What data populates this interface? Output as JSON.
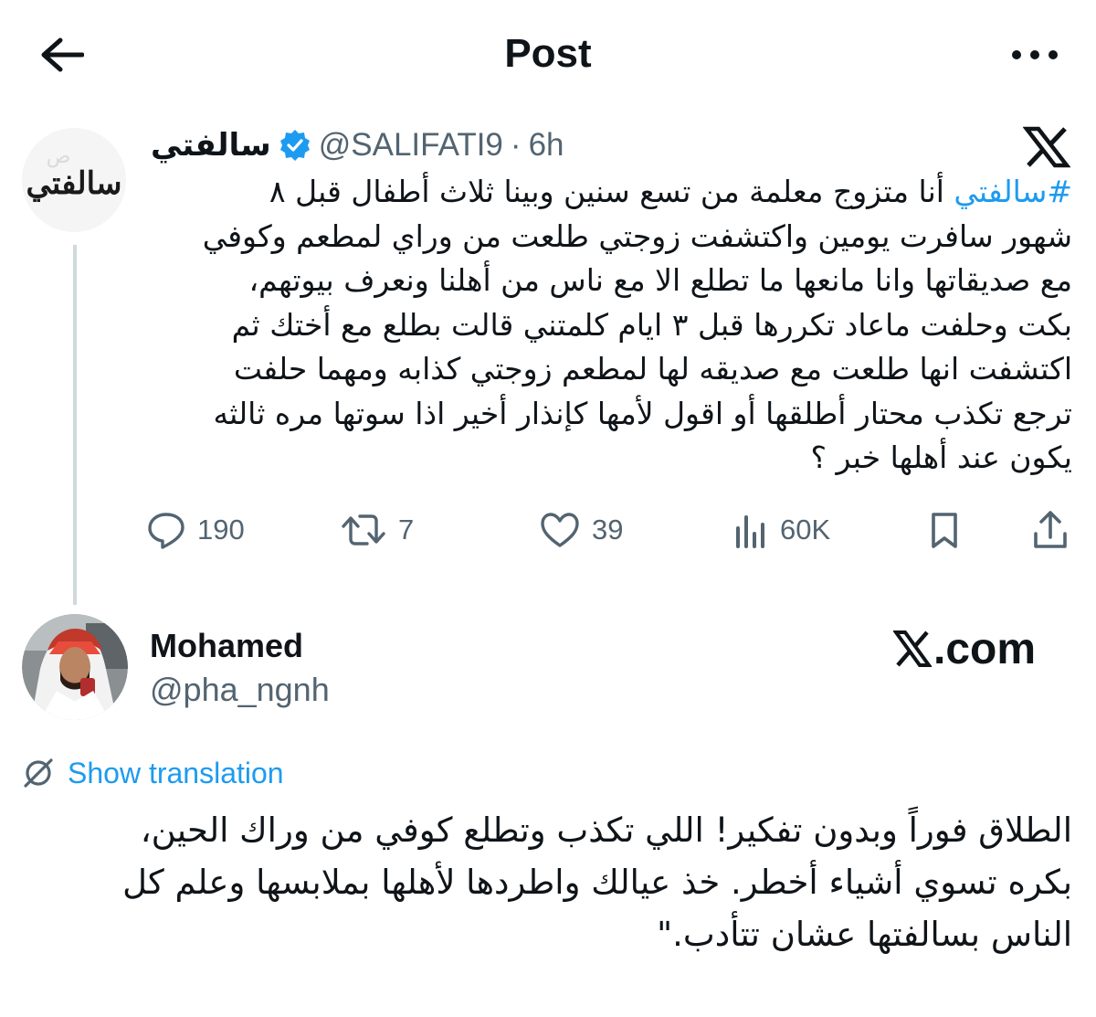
{
  "header": {
    "title": "Post",
    "back_icon": "arrow-left-icon",
    "more_icon": "more-horizontal-icon"
  },
  "tweet": {
    "author_name": "سالفتي",
    "author_handle": "@SALIFATI9",
    "separator": "·",
    "time": "6h",
    "avatar_text": "سالفتي",
    "verified_color": "#1d9bf0",
    "hashtag": "#سالفتي",
    "body_lines": [
      "أنا متزوج معلمة من تسع سنين وبينا ثلاث أطفال قبل ٨",
      "شهور سافرت يومين واكتشفت زوجتي طلعت من وراي لمطعم وكوفي",
      "مع صديقاتها وانا مانعها ما تطلع الا مع ناس من أهلنا ونعرف بيوتهم،",
      "بكت وحلفت ماعاد تكررها قبل ٣ ايام كلمتني قالت بطلع مع أختك ثم",
      "اكتشفت انها طلعت مع صديقه لها لمطعم زوجتي كذابه ومهما حلفت",
      "ترجع تكذب محتار أطلقها أو اقول لأمها كإنذار أخير اذا سوتها مره ثالثه",
      "يكون عند أهلها خبر ؟"
    ],
    "actions": {
      "replies": "190",
      "reposts": "7",
      "likes": "39",
      "views": "60K"
    }
  },
  "reply": {
    "author_name": "Mohamed",
    "author_handle": "@pha_ngnh",
    "watermark": ".com",
    "translate_label": "Show translation",
    "body_lines": [
      "الطلاق فوراً وبدون تفكير! اللي تكذب وتطلع كوفي من وراك الحين،",
      "بكره تسوي أشياء أخطر. خذ عيالك واطردها لأهلها بملابسها وعلم كل",
      "الناس بسالفتها عشان تتأدب.\""
    ]
  },
  "colors": {
    "accent": "#1d9bf0",
    "text": "#0f1419",
    "secondary": "#536471",
    "divider": "#cfd9de"
  }
}
